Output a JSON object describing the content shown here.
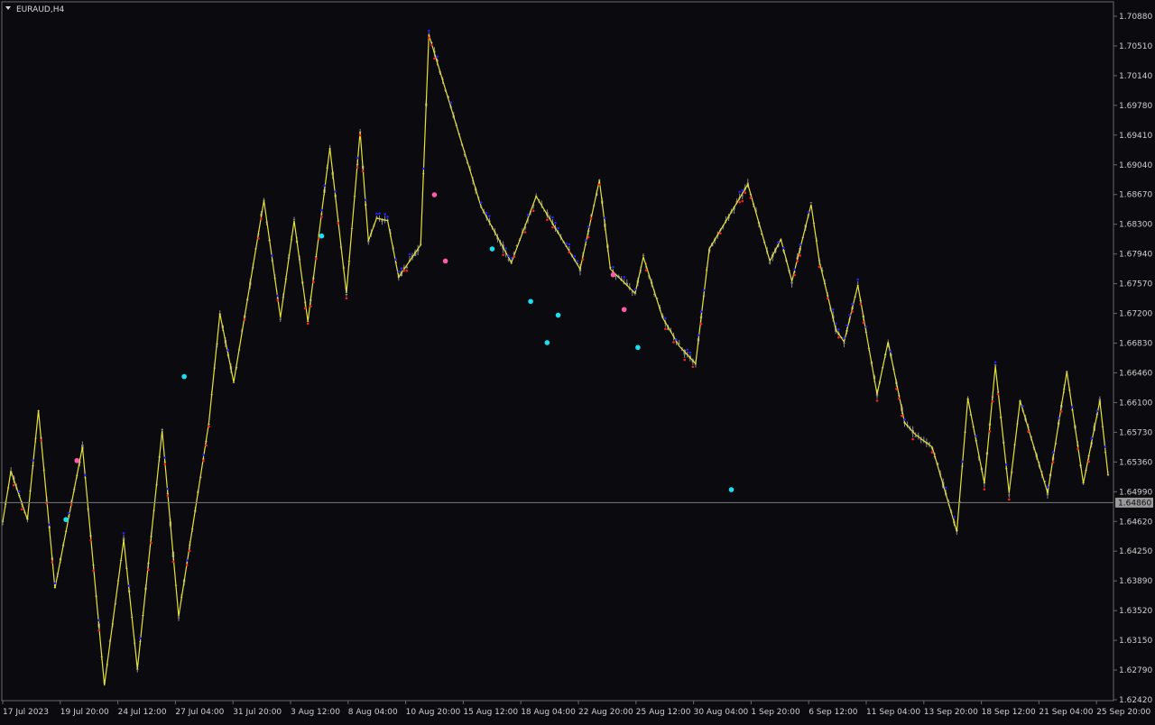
{
  "window": {
    "symbol_label": "EURAUD,H4",
    "dropdown_icon": "triangle-down-icon"
  },
  "colors": {
    "background": "#0b0b0f",
    "candle": "#8a8a8a",
    "zigzag": "#e6e23a",
    "high_dot": "#2222ff",
    "low_dot": "#ff2020",
    "signal_cyan": "#18e0f0",
    "signal_pink": "#ff5aa8",
    "axis_text": "#cfcfcf",
    "current_price_line": "#7a7a7a",
    "current_price_box": "#9a9a9a"
  },
  "chart_data": {
    "type": "line",
    "series": [],
    "y_axis": {
      "ticks": [
        "1.70880",
        "1.70510",
        "1.70140",
        "1.69780",
        "1.69410",
        "1.69040",
        "1.68670",
        "1.68300",
        "1.67940",
        "1.67570",
        "1.67200",
        "1.66830",
        "1.66460",
        "1.66100",
        "1.65730",
        "1.65360",
        "1.64990",
        "1.64620",
        "1.64250",
        "1.63890",
        "1.63520",
        "1.63150",
        "1.62790",
        "1.62420"
      ],
      "ylim": [
        1.6242,
        1.7088
      ],
      "current_price": "1.64860"
    },
    "x_axis": {
      "ticks": [
        "17 Jul 2023",
        "19 Jul 20:00",
        "24 Jul 12:00",
        "27 Jul 04:00",
        "31 Jul 20:00",
        "3 Aug 12:00",
        "8 Aug 04:00",
        "10 Aug 20:00",
        "15 Aug 12:00",
        "18 Aug 04:00",
        "22 Aug 20:00",
        "25 Aug 12:00",
        "30 Aug 04:00",
        "1 Sep 20:00",
        "6 Sep 12:00",
        "11 Sep 04:00",
        "13 Sep 20:00",
        "18 Sep 12:00",
        "21 Sep 04:00",
        "25 Sep 20:00"
      ],
      "bar_count": 290
    },
    "zigzag": [
      [
        0,
        1.6462
      ],
      [
        3,
        1.6525
      ],
      [
        9,
        1.6465
      ],
      [
        13,
        1.66
      ],
      [
        19,
        1.638
      ],
      [
        29,
        1.6555
      ],
      [
        37,
        1.626
      ],
      [
        44,
        1.644
      ],
      [
        49,
        1.628
      ],
      [
        58,
        1.6575
      ],
      [
        64,
        1.6345
      ],
      [
        75,
        1.6585
      ],
      [
        79,
        1.672
      ],
      [
        84,
        1.6635
      ],
      [
        95,
        1.686
      ],
      [
        101,
        1.6715
      ],
      [
        106,
        1.6835
      ],
      [
        111,
        1.671
      ],
      [
        119,
        1.6925
      ],
      [
        125,
        1.6745
      ],
      [
        130,
        1.6945
      ],
      [
        133,
        1.681
      ],
      [
        136,
        1.6838
      ],
      [
        140,
        1.6835
      ],
      [
        144,
        1.6765
      ],
      [
        152,
        1.6805
      ],
      [
        155,
        1.7065
      ],
      [
        174,
        1.6852
      ],
      [
        185,
        1.6783
      ],
      [
        194,
        1.6865
      ],
      [
        210,
        1.6775
      ],
      [
        217,
        1.6885
      ],
      [
        221,
        1.6775
      ],
      [
        230,
        1.6745
      ],
      [
        233,
        1.679
      ],
      [
        240,
        1.6715
      ],
      [
        246,
        1.668
      ],
      [
        252,
        1.6658
      ],
      [
        257,
        1.68
      ],
      [
        271,
        1.688
      ],
      [
        279,
        1.6785
      ],
      [
        283,
        1.6812
      ],
      [
        287,
        1.676
      ],
      [
        294,
        1.6855
      ],
      [
        297,
        1.6785
      ],
      [
        303,
        1.67
      ],
      [
        306,
        1.6685
      ],
      [
        311,
        1.6755
      ],
      [
        318,
        1.662
      ],
      [
        322,
        1.6685
      ],
      [
        328,
        1.6585
      ],
      [
        332,
        1.657
      ],
      [
        338,
        1.6555
      ],
      [
        347,
        1.645
      ],
      [
        351,
        1.6615
      ],
      [
        357,
        1.651
      ],
      [
        361,
        1.6655
      ],
      [
        366,
        1.6498
      ],
      [
        370,
        1.6612
      ],
      [
        380,
        1.6498
      ],
      [
        387,
        1.6648
      ],
      [
        393,
        1.651
      ],
      [
        399,
        1.6612
      ],
      [
        402,
        1.652
      ]
    ],
    "signals": [
      {
        "bar": 23,
        "price": 1.6465,
        "kind": "cyan"
      },
      {
        "bar": 27,
        "price": 1.6538,
        "kind": "pink"
      },
      {
        "bar": 66,
        "price": 1.6642,
        "kind": "cyan"
      },
      {
        "bar": 116,
        "price": 1.6816,
        "kind": "cyan"
      },
      {
        "bar": 157,
        "price": 1.6867,
        "kind": "pink"
      },
      {
        "bar": 161,
        "price": 1.6785,
        "kind": "pink"
      },
      {
        "bar": 178,
        "price": 1.68,
        "kind": "cyan"
      },
      {
        "bar": 192,
        "price": 1.6735,
        "kind": "cyan"
      },
      {
        "bar": 198,
        "price": 1.6684,
        "kind": "cyan"
      },
      {
        "bar": 202,
        "price": 1.6718,
        "kind": "cyan"
      },
      {
        "bar": 222,
        "price": 1.6768,
        "kind": "pink"
      },
      {
        "bar": 226,
        "price": 1.6725,
        "kind": "pink"
      },
      {
        "bar": 231,
        "price": 1.6678,
        "kind": "cyan"
      },
      {
        "bar": 265,
        "price": 1.6502,
        "kind": "cyan"
      }
    ]
  }
}
